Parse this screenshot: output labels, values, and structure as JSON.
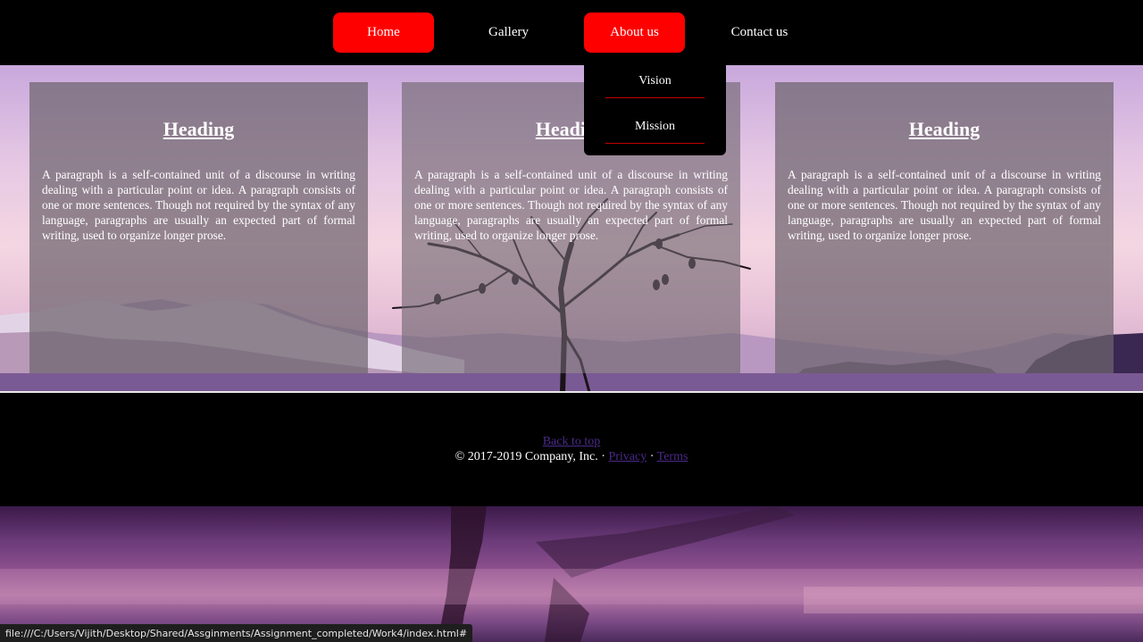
{
  "nav": {
    "items": [
      {
        "label": "Home"
      },
      {
        "label": "Gallery"
      },
      {
        "label": "About us"
      },
      {
        "label": "Contact us"
      }
    ],
    "dropdown": [
      {
        "label": "Vision"
      },
      {
        "label": "Mission"
      }
    ]
  },
  "cards": [
    {
      "heading": "Heading",
      "text": "A paragraph is a self-contained unit of a discourse in writing dealing with a particular point or idea. A paragraph consists of one or more sentences. Though not required by the syntax of any language, paragraphs are usually an expected part of formal writing, used to organize longer prose."
    },
    {
      "heading": "Heading",
      "text": "A paragraph is a self-contained unit of a discourse in writing dealing with a particular point or idea. A paragraph consists of one or more sentences. Though not required by the syntax of any language, paragraphs are usually an expected part of formal writing, used to organize longer prose."
    },
    {
      "heading": "Heading",
      "text": "A paragraph is a self-contained unit of a discourse in writing dealing with a particular point or idea. A paragraph consists of one or more sentences. Though not required by the syntax of any language, paragraphs are usually an expected part of formal writing, used to organize longer prose."
    }
  ],
  "footer": {
    "back_to_top": "Back to top",
    "copyright": "© 2017-2019 Company, Inc. · ",
    "privacy": "Privacy",
    "separator": " · ",
    "terms": "Terms"
  },
  "status_bar": {
    "url": "file:///C:/Users/Vijith/Desktop/Shared/Assginments/Assignment_completed/Work4/index.html#"
  },
  "colors": {
    "accent": "#ff0000",
    "link": "#4b2a8a"
  }
}
